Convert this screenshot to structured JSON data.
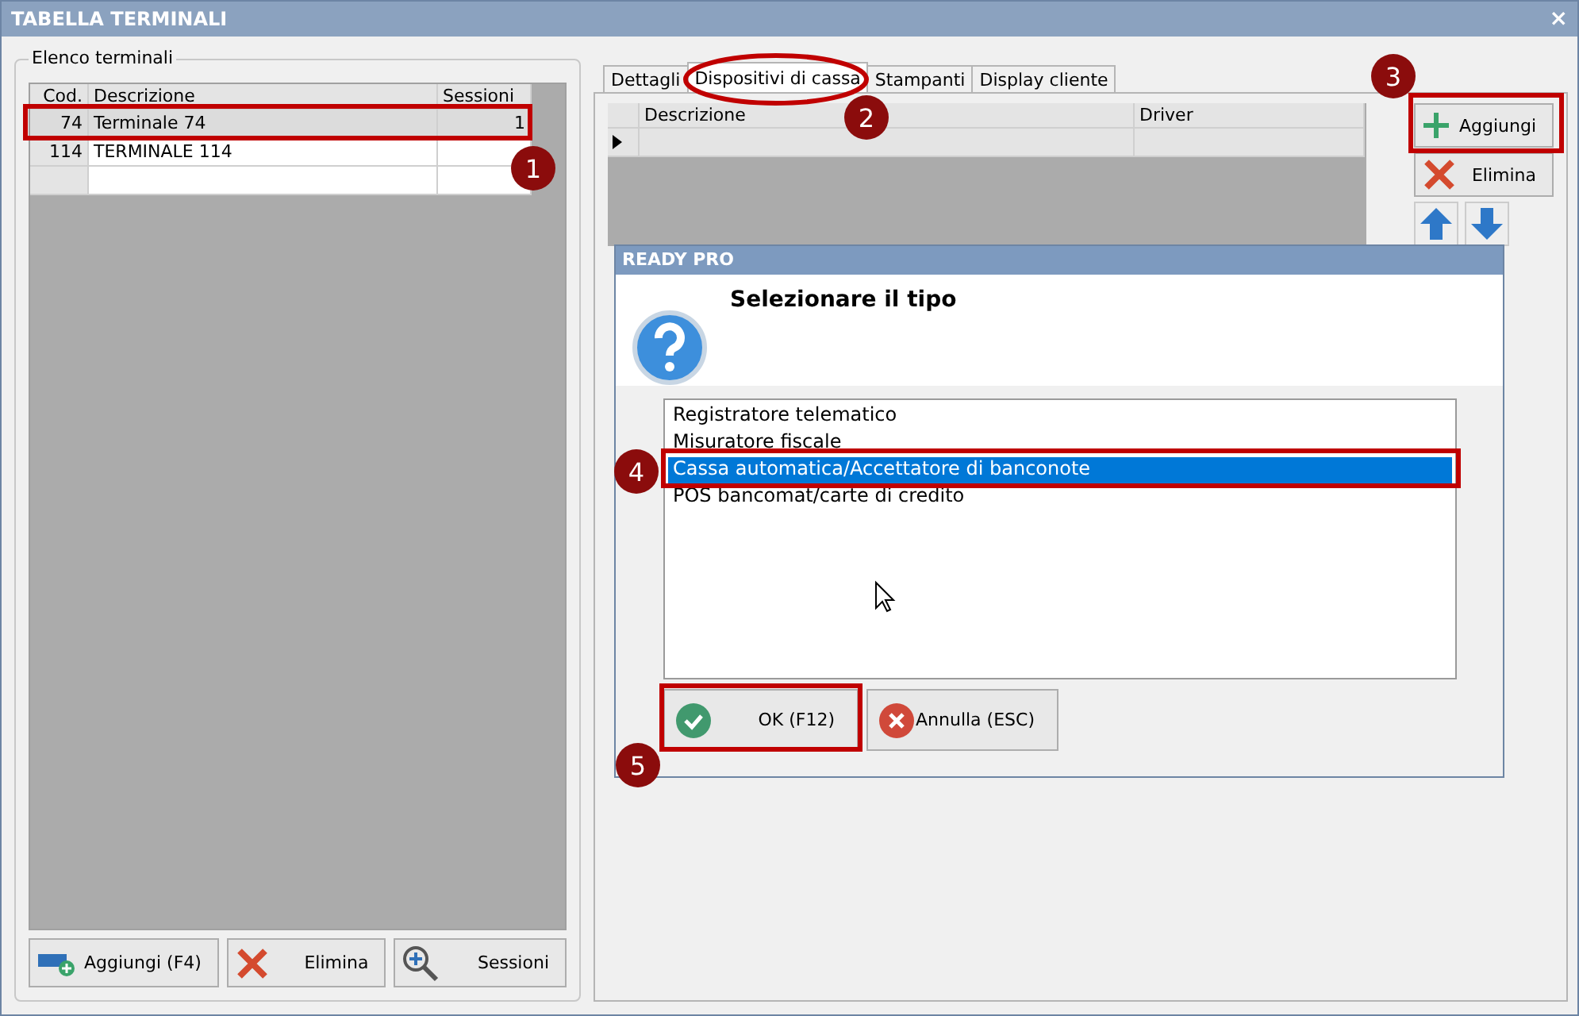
{
  "window": {
    "title": "TABELLA TERMINALI",
    "close": "×"
  },
  "terminals": {
    "legend": "Elenco terminali",
    "columns": [
      "Cod.",
      "Descrizione",
      "Sessioni"
    ],
    "rows": [
      {
        "code": "74",
        "description": "Terminale 74",
        "sessions": "1",
        "selected": true
      },
      {
        "code": "114",
        "description": "TERMINALE 114",
        "selected": false
      }
    ],
    "buttons": [
      {
        "label": "Aggiungi (F4)",
        "kind": "add"
      },
      {
        "label": "Elimina",
        "kind": "delete"
      },
      {
        "label": "Sessioni",
        "kind": "zoom"
      }
    ]
  },
  "tabs": [
    {
      "label": "Dettagli",
      "selected": false
    },
    {
      "label": "Dispositivi di cassa",
      "selected": true
    },
    {
      "label": "Stampanti",
      "selected": false
    },
    {
      "label": "Display cliente",
      "selected": false
    }
  ],
  "devices": {
    "columns": [
      "Descrizione",
      "Driver"
    ],
    "buttons": [
      {
        "label": "Aggiungi",
        "kind": "add"
      },
      {
        "label": "Elimina",
        "kind": "delete"
      }
    ]
  },
  "dialog": {
    "title": "READY PRO",
    "heading": "Selezionare il tipo",
    "options": [
      {
        "label": "Registratore telematico",
        "selected": false
      },
      {
        "label": "Misuratore fiscale",
        "selected": false
      },
      {
        "label": "Cassa automatica/Accettatore di banconote",
        "selected": true
      },
      {
        "label": "POS bancomat/carte di credito",
        "selected": false
      }
    ],
    "buttons": [
      {
        "label": "OK (F12)",
        "kind": "ok"
      },
      {
        "label": "Annulla (ESC)",
        "kind": "cancel"
      }
    ]
  },
  "callouts": [
    "1",
    "2",
    "3",
    "4",
    "5"
  ]
}
